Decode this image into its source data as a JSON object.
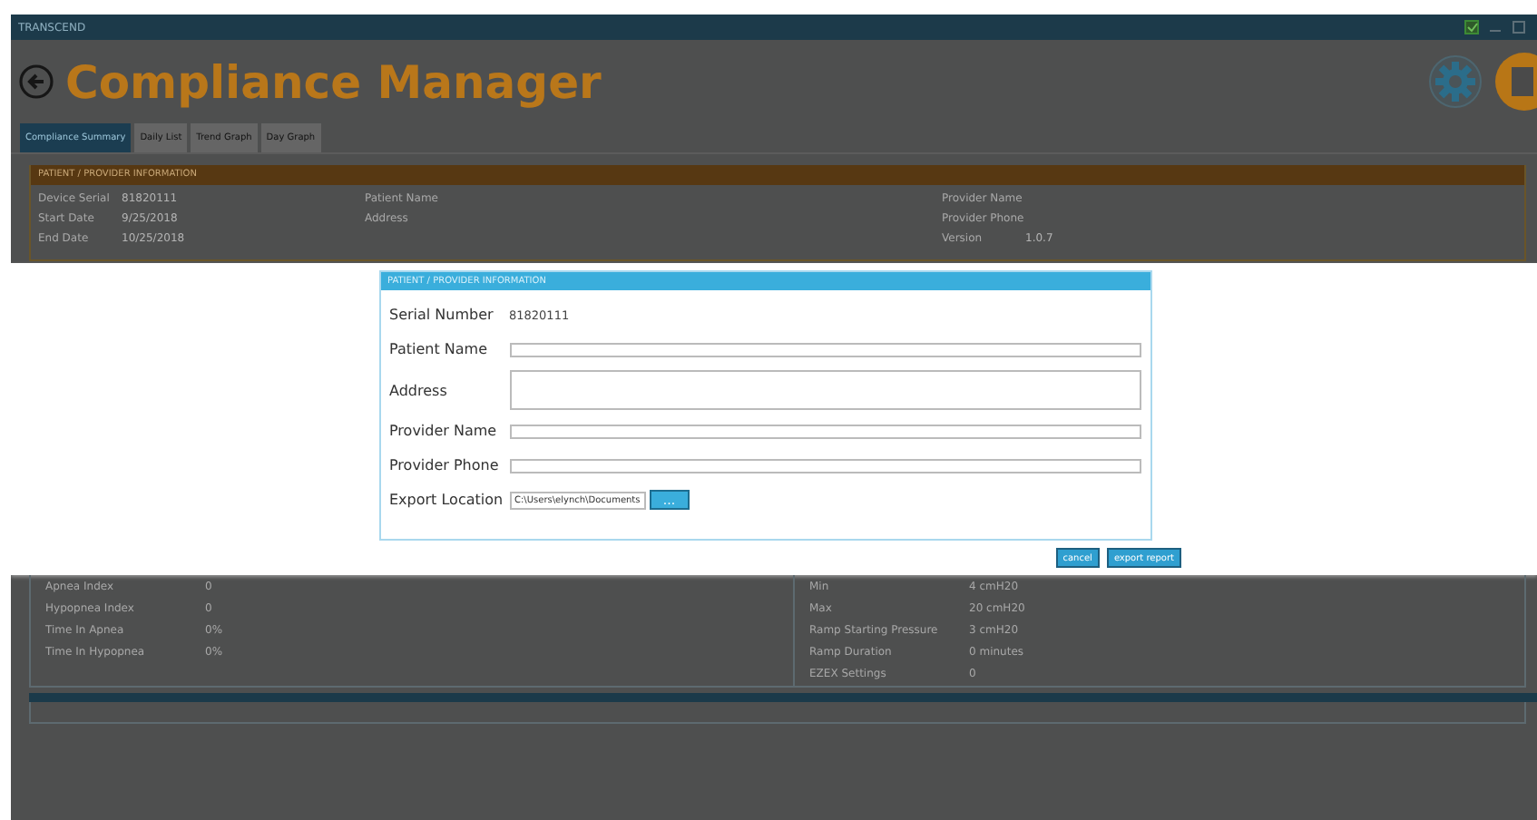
{
  "window": {
    "title": "TRANSCEND"
  },
  "header": {
    "title": "Compliance Manager"
  },
  "tabs": [
    {
      "label": "Compliance Summary",
      "selected": true
    },
    {
      "label": "Daily List",
      "selected": false
    },
    {
      "label": "Trend Graph",
      "selected": false
    },
    {
      "label": "Day Graph",
      "selected": false
    }
  ],
  "info_panel": {
    "title": "PATIENT / PROVIDER INFORMATION",
    "columns": [
      [
        {
          "label": "Device Serial",
          "value": "81820111"
        },
        {
          "label": "Start Date",
          "value": "9/25/2018"
        },
        {
          "label": "End Date",
          "value": "10/25/2018"
        }
      ],
      [
        {
          "label": "Patient Name"
        },
        {
          "label": "Address"
        }
      ],
      [
        {
          "label": "Provider Name"
        },
        {
          "label": "Provider Phone"
        },
        {
          "label": "Version",
          "value": "1.0.7"
        }
      ]
    ]
  },
  "dialog": {
    "title": "PATIENT / PROVIDER INFORMATION",
    "fields": [
      {
        "kind": "text",
        "label": "Serial Number",
        "value": "81820111"
      },
      {
        "kind": "input",
        "label": "Patient Name"
      },
      {
        "kind": "textarea",
        "label": "Address"
      },
      {
        "kind": "input",
        "label": "Provider Name"
      },
      {
        "kind": "input",
        "label": "Provider Phone"
      },
      {
        "kind": "path",
        "label": "Export Location",
        "value": "C:\\Users\\elynch\\Documents",
        "button": "..."
      }
    ],
    "buttons": [
      "cancel",
      "export report"
    ]
  },
  "stats": {
    "columns": [
      [
        {
          "label": "Apnea Index",
          "value": "0"
        },
        {
          "label": "Hypopnea Index",
          "value": "0"
        },
        {
          "label": "Time In Apnea",
          "value": "0%"
        },
        {
          "label": "Time In Hypopnea",
          "value": "0%"
        }
      ],
      [
        {
          "label": "Min",
          "value": "4 cmH20"
        },
        {
          "label": "Max",
          "value": "20 cmH20"
        },
        {
          "label": "Ramp Starting Pressure",
          "value": "3 cmH20"
        },
        {
          "label": "Ramp Duration",
          "value": "0 minutes"
        },
        {
          "label": "EZEX Settings",
          "value": "0"
        }
      ]
    ]
  }
}
